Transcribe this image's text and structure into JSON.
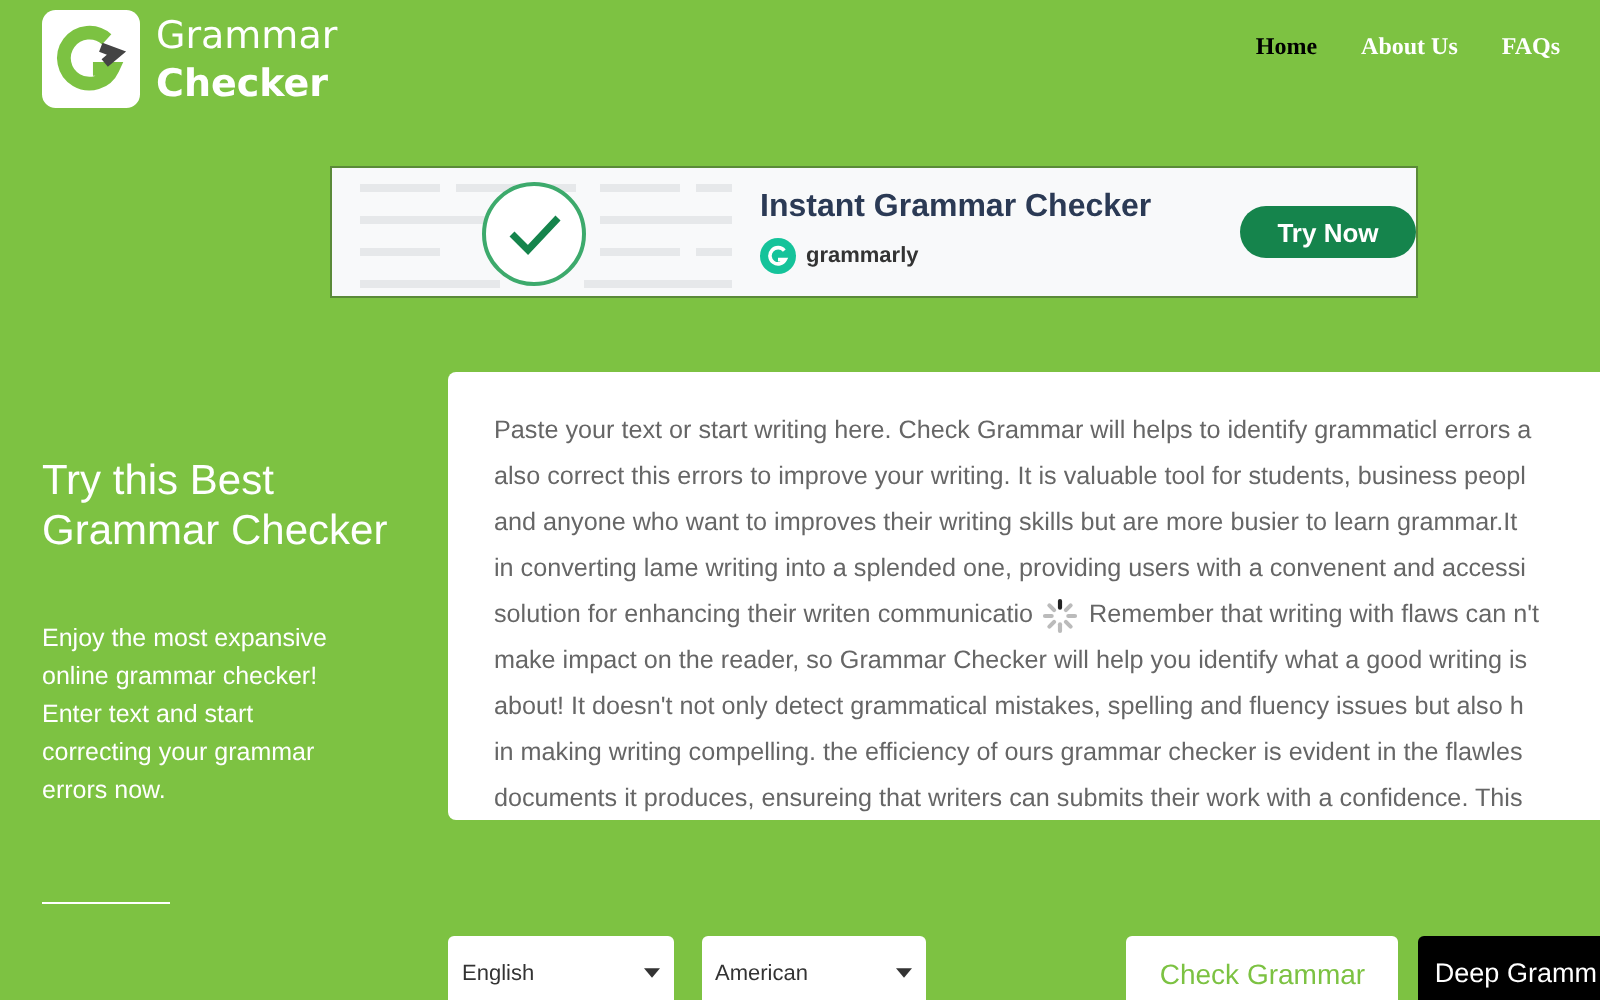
{
  "logo": {
    "line_1": "Grammar",
    "line_2": "Checker"
  },
  "nav": [
    {
      "label": "Home",
      "selected": true
    },
    {
      "label": "About Us",
      "selected": false
    },
    {
      "label": "FAQs",
      "selected": false
    }
  ],
  "ad": {
    "title": "Instant Grammar Checker",
    "brand": "grammarly",
    "button": "Try Now"
  },
  "hero": {
    "title": "Try this Best Grammar Checker",
    "text": "Enjoy the most expansive online grammar checker! Enter text and start correcting your grammar errors now."
  },
  "editor": {
    "lines": [
      {
        "text": "Paste your text or start writing here. Check Grammar will helps to identify grammaticl errors a",
        "loading": false
      },
      {
        "text": "also correct this errors to improve your writing. It is valuable tool for students, business peopl",
        "loading": false
      },
      {
        "text": "and anyone who want to improves their writing skills but are more busier to learn grammar.It",
        "loading": false
      },
      {
        "text": "in converting lame writing into a splended one, providing users with a convenent and accessi",
        "loading": false
      },
      {
        "text": "solution for enhancing their writen communicatio",
        "loading": true,
        "rest": "Remember that writing with flaws can n't"
      },
      {
        "text": "make impact on the reader, so Grammar Checker will help you identify what a good writing is",
        "loading": false
      },
      {
        "text": "about! It doesn't not only detect grammatical mistakes, spelling and fluency issues but also h",
        "loading": false
      },
      {
        "text": "in making writing compelling. the efficiency of ours grammar checker is evident in the flawles",
        "loading": false
      },
      {
        "text": "documents it produces, ensureing that writers can submits their work with a confidence. This",
        "loading": false
      }
    ]
  },
  "controls": {
    "language": "English",
    "dialect": "American",
    "check_button": "Check Grammar",
    "deep_button": "Deep Gramm"
  }
}
